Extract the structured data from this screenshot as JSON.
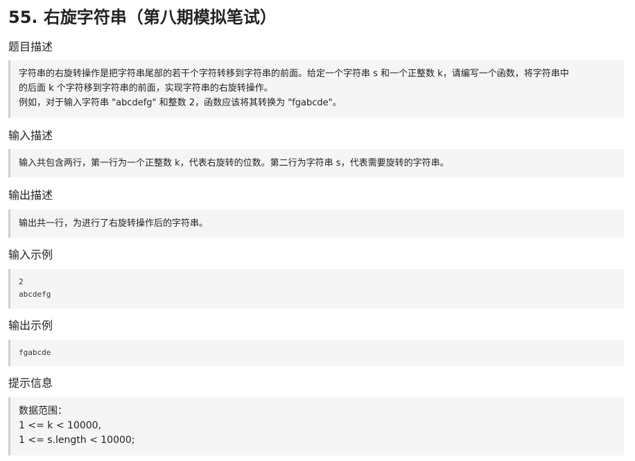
{
  "title": "55. 右旋字符串（第八期模拟笔试）",
  "sections": {
    "description": {
      "heading": "题目描述",
      "lines": [
        "字符串的右旋转操作是把字符串尾部的若干个字符转移到字符串的前面。给定一个字符串 s 和一个正整数 k，请编写一个函数，将字符串中",
        "的后面 k 个字符移到字符串的前面，实现字符串的右旋转操作。",
        "例如，对于输入字符串 \"abcdefg\" 和整数 2，函数应该将其转换为 \"fgabcde\"。"
      ]
    },
    "input": {
      "heading": "输入描述",
      "lines": [
        "输入共包含两行，第一行为一个正整数 k，代表右旋转的位数。第二行为字符串 s，代表需要旋转的字符串。"
      ]
    },
    "output": {
      "heading": "输出描述",
      "lines": [
        "输出共一行，为进行了右旋转操作后的字符串。"
      ]
    },
    "input_example": {
      "heading": "输入示例",
      "lines": [
        "2",
        "abcdefg"
      ]
    },
    "output_example": {
      "heading": "输出示例",
      "lines": [
        "fgabcde"
      ]
    },
    "hints": {
      "heading": "提示信息",
      "lines": [
        "数据范围：",
        "1 <= k < 10000,",
        "1 <= s.length < 10000;"
      ]
    }
  }
}
